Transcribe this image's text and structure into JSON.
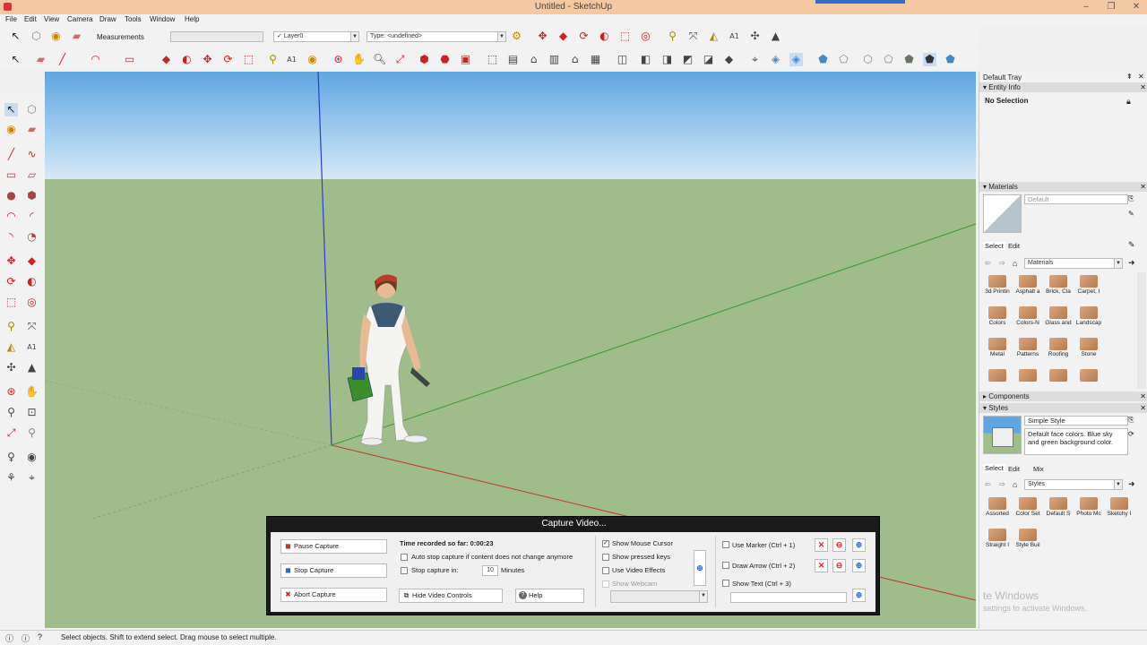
{
  "app": {
    "title": "Untitled - SketchUp"
  },
  "menu": [
    "File",
    "Edit",
    "View",
    "Camera",
    "Draw",
    "Tools",
    "Window",
    "Help"
  ],
  "toolbar": {
    "measurements_label": "Measurements",
    "layer_value": "Layer0",
    "type_value": "Type: <undefined>"
  },
  "tray": {
    "title": "Default Tray",
    "entity_info": {
      "header": "Entity Info",
      "value": "No Selection"
    },
    "materials": {
      "header": "Materials",
      "current": "Default",
      "tab_select": "Select",
      "tab_edit": "Edit",
      "library": "Materials",
      "items": [
        "3d Printin",
        "Asphalt a",
        "Brick, Cla",
        "Carpet, I",
        "Colors",
        "Colors-N",
        "Glass and",
        "Landscap",
        "Metal",
        "Patterns",
        "Roofing",
        "Stone",
        "",
        "",
        "",
        ""
      ]
    },
    "components": {
      "header": "Components"
    },
    "styles": {
      "header": "Styles",
      "name": "Simple Style",
      "description": "Default face colors. Blue sky and green background color.",
      "tab_select": "Select",
      "tab_edit": "Edit",
      "tab_mix": "Mix",
      "library": "Styles",
      "items": [
        "Assorted",
        "Color Set",
        "Default S",
        "Photo Mc",
        "Sketchy I",
        "Straight I",
        "Style Buil"
      ]
    }
  },
  "capture": {
    "title": "Capture Video...",
    "pause": "Pause Capture",
    "stop": "Stop Capture",
    "abort": "Abort Capture",
    "time": "Time recorded so far: 0:00:23",
    "auto_stop": "Auto stop capture if content does not change anymore",
    "stop_in": "Stop capture in:",
    "stop_in_value": "10",
    "minutes": "Minutes",
    "hide_controls": "Hide Video Controls",
    "help": "Help",
    "show_cursor": "Show Mouse Cursor",
    "show_keys": "Show pressed keys",
    "use_effects": "Use Video Effects",
    "show_webcam": "Show Webcam",
    "use_marker": "Use Marker (Ctrl + 1)",
    "draw_arrow": "Draw Arrow (Ctrl + 2)",
    "show_text": "Show Text (Ctrl + 3)"
  },
  "watermark": {
    "line1": "te Windows",
    "line2": "settings to activate Windows."
  },
  "status": {
    "text": "Select objects. Shift to extend select. Drag mouse to select multiple."
  },
  "colors": {
    "sky_top": "#5fa6e2",
    "ground": "#9fbd8a",
    "x_axis": "#c0392b",
    "y_axis": "#2e9e2e",
    "z_axis": "#2c3ecf"
  }
}
